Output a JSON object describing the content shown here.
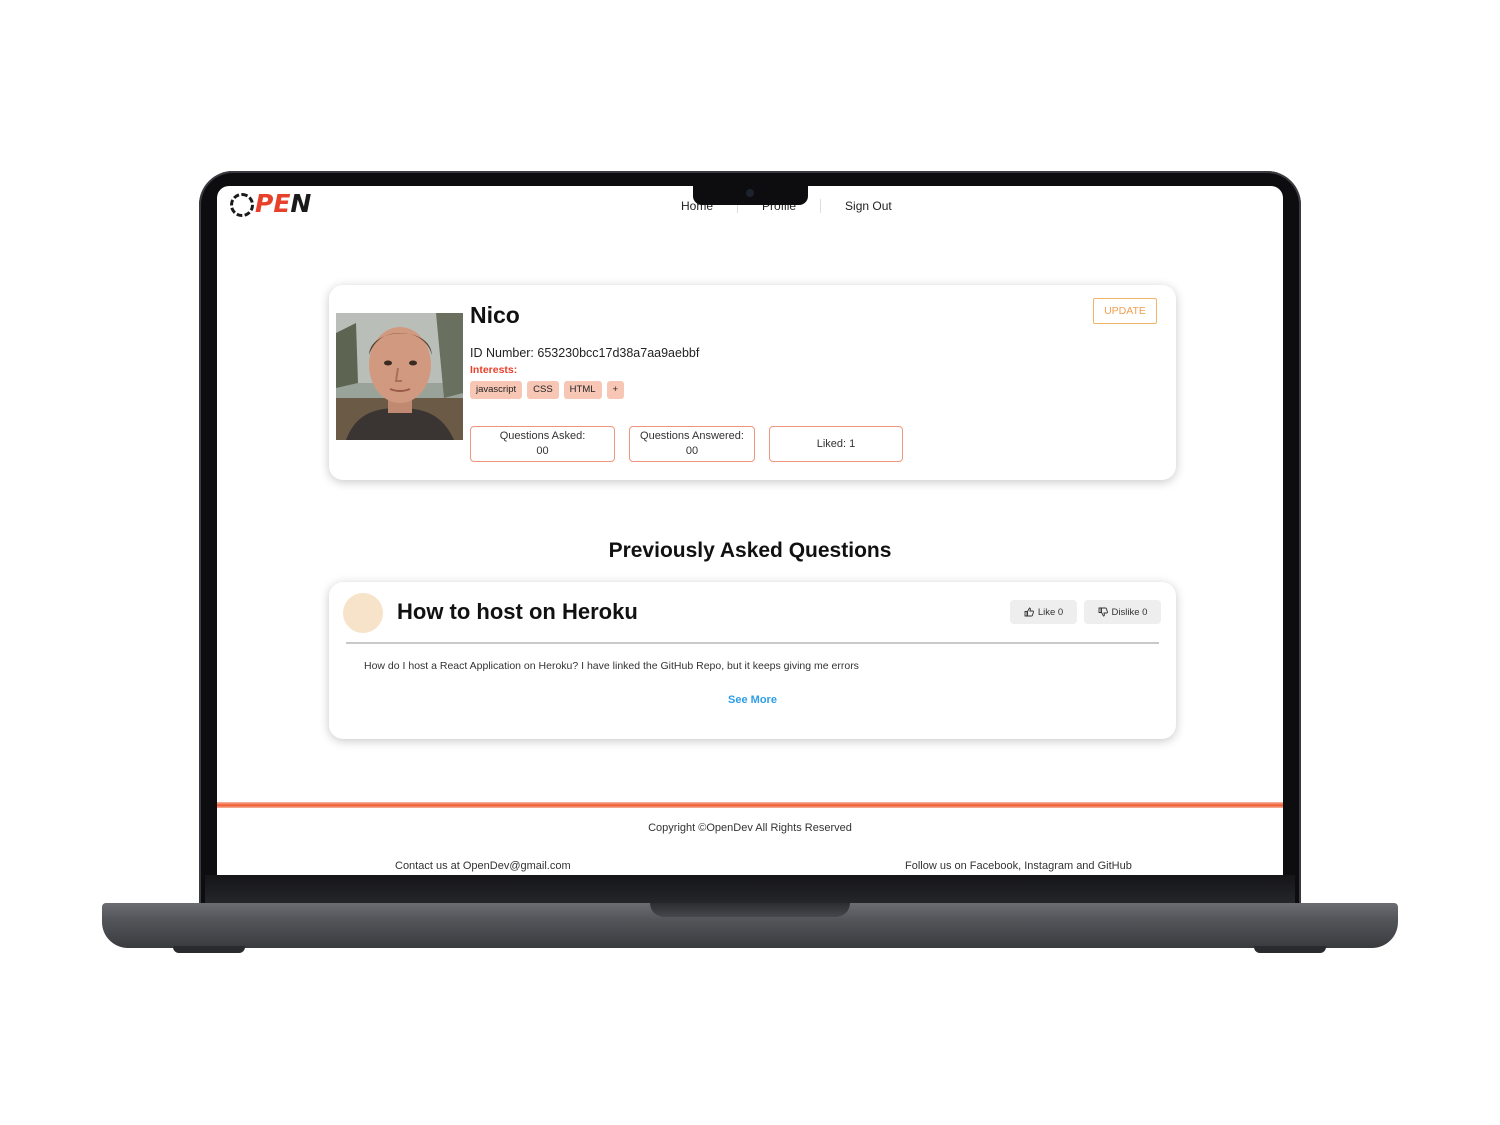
{
  "brand": {
    "logo_o": "O",
    "logo_pe": "PE",
    "logo_n": "N"
  },
  "nav": {
    "items": [
      "Home",
      "Profile",
      "Sign Out"
    ]
  },
  "profile": {
    "name": "Nico",
    "id_line": "ID Number: 653230bcc17d38a7aa9aebbf",
    "interests_label": "Interests:",
    "tags": [
      "javascript",
      "CSS",
      "HTML",
      "+"
    ],
    "update_label": "UPDATE",
    "stats": {
      "asked_label": "Questions Asked:",
      "asked_value": "00",
      "answered_label": "Questions Answered:",
      "answered_value": "00",
      "liked": "Liked: 1"
    }
  },
  "section_title": "Previously Asked Questions",
  "question": {
    "title": "How to host on Heroku",
    "like_label": "Like 0",
    "dislike_label": "Dislike 0",
    "body": "How do I host a React Application on Heroku? I have linked the GitHub Repo, but it keeps giving me errors",
    "see_more": "See More"
  },
  "footer": {
    "copyright": "Copyright ©OpenDev All Rights Reserved",
    "contact": "Contact us at OpenDev@gmail.com",
    "follow": "Follow us on Facebook, Instagram and GitHub"
  },
  "colors": {
    "accent": "#e8412b",
    "tag_bg": "#f7c6b5",
    "link": "#2f9ee6",
    "update": "#f0a050"
  }
}
